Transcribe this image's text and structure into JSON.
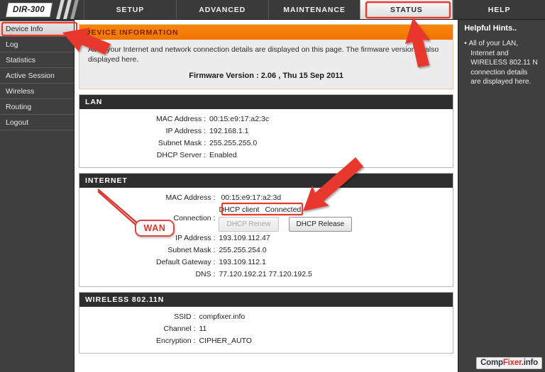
{
  "window": {
    "device_model": "DIR-300"
  },
  "topnav": {
    "tabs": [
      {
        "label": "SETUP",
        "active": false
      },
      {
        "label": "ADVANCED",
        "active": false
      },
      {
        "label": "MAINTENANCE",
        "active": false
      },
      {
        "label": "STATUS",
        "active": true
      },
      {
        "label": "HELP",
        "active": false
      }
    ]
  },
  "sidebar": {
    "items": [
      {
        "label": "Device Info",
        "active": true
      },
      {
        "label": "Log",
        "active": false
      },
      {
        "label": "Statistics",
        "active": false
      },
      {
        "label": "Active Session",
        "active": false
      },
      {
        "label": "Wireless",
        "active": false
      },
      {
        "label": "Routing",
        "active": false
      },
      {
        "label": "Logout",
        "active": false
      }
    ]
  },
  "device_information": {
    "header": "DEVICE INFORMATION",
    "intro": "All of your Internet and network connection details are displayed on this page. The firmware version is also displayed here.",
    "firmware_line": "Firmware Version : 2.06 ,  Thu 15 Sep 2011"
  },
  "lan": {
    "header": "LAN",
    "rows": [
      {
        "label": "MAC Address :",
        "value": "00:15:e9:17:a2:3c"
      },
      {
        "label": "IP Address :",
        "value": "192.168.1.1"
      },
      {
        "label": "Subnet Mask :",
        "value": "255.255.255.0"
      },
      {
        "label": "DHCP Server :",
        "value": "Enabled"
      }
    ]
  },
  "internet": {
    "header": "INTERNET",
    "mac_label": "MAC Address :",
    "mac_value": "00:15:e9:17:a2:3d",
    "connection_label": "Connection :",
    "connection_type": "DHCP client",
    "connection_status": "Connected",
    "renew_button": "DHCP Renew",
    "release_button": "DHCP Release",
    "rows": [
      {
        "label": "IP Address :",
        "value": "193.109.112.47"
      },
      {
        "label": "Subnet Mask :",
        "value": "255.255.254.0"
      },
      {
        "label": "Default Gateway :",
        "value": "193.109.112.1"
      },
      {
        "label": "DNS :",
        "value": "77.120.192.21 77.120.192.5"
      }
    ]
  },
  "wireless": {
    "header": "WIRELESS 802.11N",
    "rows": [
      {
        "label": "SSID :",
        "value": "compfixer.info"
      },
      {
        "label": "Channel :",
        "value": "11"
      },
      {
        "label": "Encryption :",
        "value": "CIPHER_AUTO"
      }
    ]
  },
  "hints": {
    "title": "Helpful Hints..",
    "items": [
      "All of your LAN, Internet and WIRELESS 802.11 N connection details are displayed here."
    ]
  },
  "annotations": {
    "accent_color": "#e8392f",
    "wan_callout": "WAN"
  },
  "watermark": {
    "part1": "Comp",
    "part2": "Fixer",
    "part3": ".info"
  }
}
